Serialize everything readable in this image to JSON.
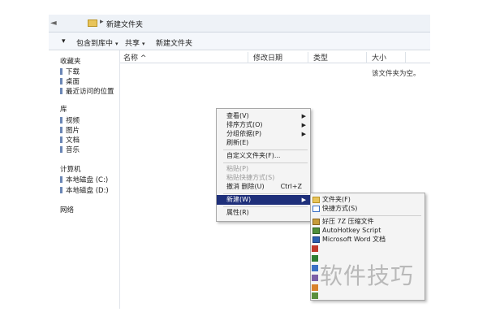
{
  "address": {
    "path": "新建文件夹"
  },
  "toolbar": {
    "include": "包含到库中",
    "share": "共享",
    "new_folder": "新建文件夹"
  },
  "sidebar": {
    "favorites": "收藏夹",
    "fav_items": [
      "下载",
      "桌面",
      "最近访问的位置"
    ],
    "libraries": "库",
    "lib_items": [
      "视频",
      "图片",
      "文档",
      "音乐"
    ],
    "computer": "计算机",
    "comp_items": [
      "本地磁盘 (C:)",
      "本地磁盘 (D:)"
    ],
    "network": "网络"
  },
  "columns": {
    "name": "名称 ^",
    "modified": "修改日期",
    "type": "类型",
    "size": "大小"
  },
  "empty_text": "该文件夹为空。",
  "context_menu": {
    "view": "查看(V)",
    "sort": "排序方式(O)",
    "group": "分组依据(P)",
    "refresh": "刷新(E)",
    "customize": "自定义文件夹(F)...",
    "paste": "粘贴(P)",
    "paste_shortcut": "粘贴快捷方式(S)",
    "undo": "撤消 删除(U)",
    "undo_shortcut": "Ctrl+Z",
    "new": "新建(W)",
    "properties": "属性(R)"
  },
  "submenu": {
    "folder": "文件夹(F)",
    "shortcut": "快捷方式(S)",
    "zip": "好压 7Z 压缩文件",
    "autohotkey": "AutoHotkey Script",
    "word": "Microsoft Word 文档"
  },
  "watermark": "软件技巧",
  "colors": {
    "highlight": "#1e2f7a",
    "folder": "#e8c45a",
    "watermark": "#b9b9b9"
  }
}
